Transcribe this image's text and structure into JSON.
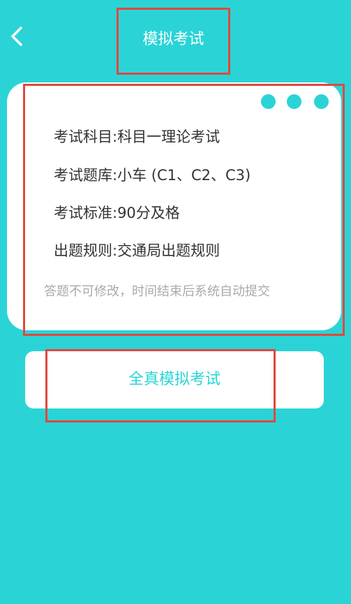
{
  "header": {
    "back_icon": "chevron-left-icon",
    "title": "模拟考试"
  },
  "exam_info": {
    "subject": "考试科目:科目一理论考试",
    "question_bank": "考试题库:小车 (C1、C2、C3)",
    "standard": "考试标准:90分及格",
    "rules": "出题规则:交通局出题规则",
    "note": "答题不可修改，时间结束后系统自动提交"
  },
  "actions": {
    "start_label": "全真模拟考试"
  },
  "colors": {
    "background": "#2ad4d6",
    "accent": "#2ad4d6",
    "card": "#ffffff",
    "highlight_outline": "#e0483f"
  }
}
